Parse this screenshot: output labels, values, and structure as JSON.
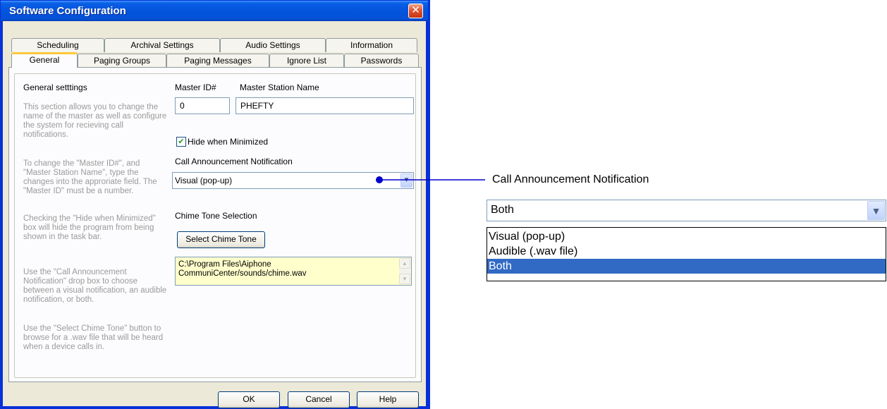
{
  "window": {
    "title": "Software Configuration",
    "close_glyph": "✕"
  },
  "tabs_row1": [
    "Scheduling",
    "Archival Settings",
    "Audio Settings",
    "Information"
  ],
  "tabs_row2": [
    "General",
    "Paging Groups",
    "Paging Messages",
    "Ignore List",
    "Passwords"
  ],
  "active_tab": "General",
  "general": {
    "heading": "General setttings",
    "help_paragraphs": [
      "This section allows you to change the name of the master as well as configure the system for recieving call notifications.",
      "To change the \"Master ID#\", and \"Master Station Name\", type the changes into the approriate field. The \"Master ID\" must be a number.",
      "Checking the \"Hide when Minimized\" box will hide the program from being shown in the task bar.",
      "Use the \"Call Announcement Notification\" drop box to choose between a visual notification, an audible notification, or both.",
      "Use the \"Select Chime Tone\" button to browse for a .wav file that will be heard when a device calls in."
    ],
    "master_id_label": "Master ID#",
    "master_id_value": "0",
    "master_name_label": "Master Station Name",
    "master_name_value": "PHEFTY",
    "hide_minimized_label": "Hide when Minimized",
    "hide_minimized_checked": true,
    "call_notification_label": "Call Announcement Notification",
    "call_notification_value": "Visual (pop-up)",
    "chime_label": "Chime Tone Selection",
    "chime_button": "Select Chime Tone",
    "chime_path": "C:\\Program Files\\Aiphone CommuniCenter/sounds/chime.wav"
  },
  "footer_buttons": {
    "ok": "OK",
    "cancel": "Cancel",
    "help": "Help"
  },
  "zoom_callout": {
    "label": "Call Announcement Notification",
    "selected_value": "Both",
    "options": [
      "Visual (pop-up)",
      "Audible (.wav file)",
      "Both"
    ],
    "highlighted_option": "Both"
  },
  "colors": {
    "title_bar": "#0453dc",
    "dialog_bg": "#ece9d8",
    "active_tab_accent": "#ffc83c",
    "selection": "#316ac5",
    "callout_line": "#0000cc"
  },
  "icons": {
    "dropdown": "chevron-down-icon",
    "checkbox": "check-icon",
    "close": "close-icon"
  }
}
